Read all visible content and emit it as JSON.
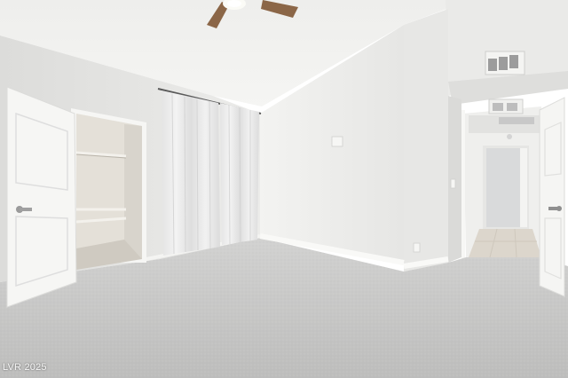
{
  "watermark": {
    "text": "LVR 2025"
  },
  "palette": {
    "wall": "#e9e9e7",
    "ceiling": "#f1f1ef",
    "carpet": "#c9c9c8",
    "trim": "#f7f7f5",
    "door": "#f4f4f2",
    "fan_blade": "#8b6647"
  }
}
